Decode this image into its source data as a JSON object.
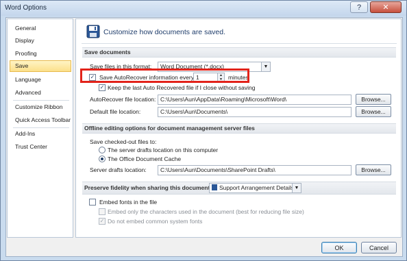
{
  "window": {
    "title": "Word Options",
    "help_glyph": "?",
    "close_glyph": "✕"
  },
  "nav": {
    "items": [
      {
        "label": "General"
      },
      {
        "label": "Display"
      },
      {
        "label": "Proofing"
      },
      {
        "label": "Save",
        "selected": true
      },
      {
        "label": "Language"
      },
      {
        "label": "Advanced"
      },
      {
        "label": "Customize Ribbon"
      },
      {
        "label": "Quick Access Toolbar"
      },
      {
        "label": "Add-Ins"
      },
      {
        "label": "Trust Center"
      }
    ]
  },
  "header": {
    "icon": "save-floppy-icon",
    "text": "Customize how documents are saved."
  },
  "save_documents": {
    "title": "Save documents",
    "format_label": "Save files in this format:",
    "format_value": "Word Document (*.docx)",
    "autorecover_label": "Save AutoRecover information every",
    "autorecover_checked": true,
    "autorecover_minutes": "1",
    "minutes_label": "minutes",
    "keep_last_label": "Keep the last Auto Recovered file if I close without saving",
    "keep_last_checked": true,
    "autorecover_location_label": "AutoRecover file location:",
    "autorecover_location_value": "C:\\Users\\Aun\\AppData\\Roaming\\Microsoft\\Word\\",
    "default_location_label": "Default file location:",
    "default_location_value": "C:\\Users\\Aun\\Documents\\",
    "browse_label": "Browse..."
  },
  "offline": {
    "title": "Offline editing options for document management server files",
    "save_checked_out_label": "Save checked-out files to:",
    "radio_server_label": "The server drafts location on this computer",
    "radio_cache_label": "The Office Document Cache",
    "selected": "cache",
    "server_drafts_label": "Server drafts location:",
    "server_drafts_value": "C:\\Users\\Aun\\Documents\\SharePoint Drafts\\",
    "browse_label": "Browse..."
  },
  "fidelity": {
    "title": "Preserve fidelity when sharing this document:",
    "document": "Support Arrangement Details",
    "embed_fonts_label": "Embed fonts in the file",
    "embed_fonts_checked": false,
    "embed_chars_label": "Embed only the characters used in the document (best for reducing file size)",
    "no_common_label": "Do not embed common system fonts",
    "no_common_checked": true
  },
  "buttons": {
    "ok": "OK",
    "cancel": "Cancel"
  },
  "colors": {
    "highlight": "#e2231a",
    "accent": "#1f3d6b"
  }
}
